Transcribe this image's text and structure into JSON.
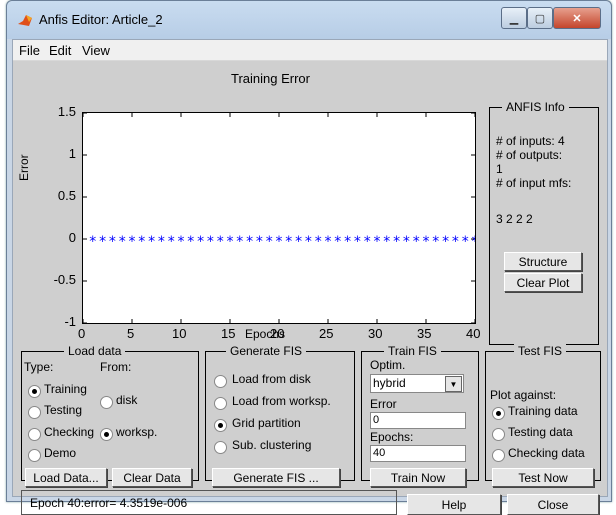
{
  "window": {
    "title": "Anfis Editor: Article_2"
  },
  "menu": [
    "File",
    "Edit",
    "View"
  ],
  "plot": {
    "title": "Training Error",
    "xlabel": "Epochs",
    "ylabel": "Error",
    "xticks": [
      "0",
      "5",
      "10",
      "15",
      "20",
      "25",
      "30",
      "35",
      "40"
    ],
    "yticks": [
      "1.5",
      "1",
      "0.5",
      "0",
      "-0.5",
      "-1"
    ]
  },
  "chart_data": {
    "type": "scatter",
    "title": "Training Error",
    "xlabel": "Epochs",
    "ylabel": "Error",
    "xlim": [
      0,
      40
    ],
    "ylim": [
      -1,
      1.5
    ],
    "marker": "*",
    "color": "#0000ff",
    "x": [
      1,
      2,
      3,
      4,
      5,
      6,
      7,
      8,
      9,
      10,
      11,
      12,
      13,
      14,
      15,
      16,
      17,
      18,
      19,
      20,
      21,
      22,
      23,
      24,
      25,
      26,
      27,
      28,
      29,
      30,
      31,
      32,
      33,
      34,
      35,
      36,
      37,
      38,
      39,
      40
    ],
    "y": [
      0,
      0,
      0,
      0,
      0,
      0,
      0,
      0,
      0,
      0,
      0,
      0,
      0,
      0,
      0,
      0,
      0,
      0,
      0,
      0,
      0,
      0,
      0,
      0,
      0,
      0,
      0,
      0,
      0,
      0,
      0,
      0,
      0,
      0,
      0,
      0,
      0,
      0,
      0,
      0
    ]
  },
  "info": {
    "title": "ANFIS Info",
    "inputs": "# of inputs: 4",
    "outputs": "# of outputs:",
    "outputs_val": "1",
    "mfs": "# of input mfs:",
    "mfs_val": "3 2 2 2",
    "structure_btn": "Structure",
    "clear_plot_btn": "Clear Plot"
  },
  "load_data": {
    "title": "Load data",
    "type_label": "Type:",
    "from_label": "From:",
    "types": [
      "Training",
      "Testing",
      "Checking",
      "Demo"
    ],
    "type_selected": "Training",
    "sources": [
      "disk",
      "worksp."
    ],
    "source_selected": "worksp.",
    "load_btn": "Load Data...",
    "clear_btn": "Clear Data"
  },
  "generate_fis": {
    "title": "Generate FIS",
    "options": [
      "Load from disk",
      "Load from worksp.",
      "Grid partition",
      "Sub. clustering"
    ],
    "selected": "Grid partition",
    "button": "Generate FIS ..."
  },
  "train_fis": {
    "title": "Train FIS",
    "optim_label": "Optim.",
    "optim_value": "hybrid",
    "error_label": "Error",
    "error_value": "0",
    "epochs_label": "Epochs:",
    "epochs_value": "40",
    "button": "Train Now"
  },
  "test_fis": {
    "title": "Test FIS",
    "plot_against": "Plot against:",
    "options": [
      "Training data",
      "Testing data",
      "Checking data"
    ],
    "selected": "Training data",
    "button": "Test Now"
  },
  "status": "Epoch 40:error= 4.3519e-006",
  "help_btn": "Help",
  "close_btn": "Close"
}
